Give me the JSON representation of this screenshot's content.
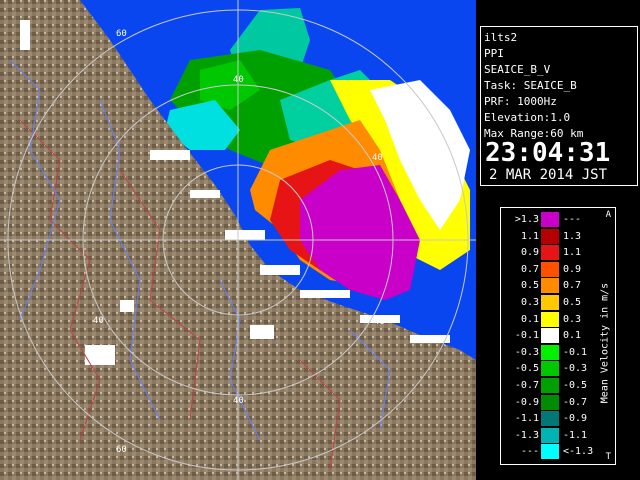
{
  "info": {
    "radar_name": "ilts2",
    "display_type": "PPI",
    "product": "SEAICE_B_V",
    "task": "Task: SEAICE_B",
    "prf": "PRF: 1000Hz",
    "elevation": "Elevation:1.0",
    "max_range": "Max Range:60 km",
    "time": "23:04:31",
    "date": "2 MAR 2014 JST"
  },
  "map": {
    "range_rings_km": [
      20,
      40,
      60
    ],
    "range_labels": {
      "n60": "60",
      "n40": "40",
      "ne40": "40",
      "se40": "40",
      "w40": "40",
      "s40": "40",
      "s60": "60"
    },
    "colors": {
      "background": "#0a46f0",
      "land": "#7a6a55",
      "ring": "#c8c8c8"
    }
  },
  "legend": {
    "title": "Mean Velocity in m/s",
    "marker_top": "A",
    "marker_bottom": "T",
    "rows": [
      {
        "lo": ">1.3",
        "hi": "---",
        "color": "#c800c8"
      },
      {
        "lo": "1.1",
        "hi": "1.3",
        "color": "#b40000"
      },
      {
        "lo": "0.9",
        "hi": "1.1",
        "color": "#e61414"
      },
      {
        "lo": "0.7",
        "hi": "0.9",
        "color": "#ff5000"
      },
      {
        "lo": "0.5",
        "hi": "0.7",
        "color": "#ff8c00"
      },
      {
        "lo": "0.3",
        "hi": "0.5",
        "color": "#ffc800"
      },
      {
        "lo": "0.1",
        "hi": "0.3",
        "color": "#ffff00"
      },
      {
        "lo": "-0.1",
        "hi": "0.1",
        "color": "#ffffff"
      },
      {
        "lo": "-0.3",
        "hi": "-0.1",
        "color": "#00f000"
      },
      {
        "lo": "-0.5",
        "hi": "-0.3",
        "color": "#00c800"
      },
      {
        "lo": "-0.7",
        "hi": "-0.5",
        "color": "#00a000"
      },
      {
        "lo": "-0.9",
        "hi": "-0.7",
        "color": "#008c00"
      },
      {
        "lo": "-1.1",
        "hi": "-0.9",
        "color": "#007878"
      },
      {
        "lo": "-1.3",
        "hi": "-1.1",
        "color": "#00b4b4"
      },
      {
        "lo": "---",
        "hi": "<-1.3",
        "color": "#00ffff"
      }
    ]
  }
}
